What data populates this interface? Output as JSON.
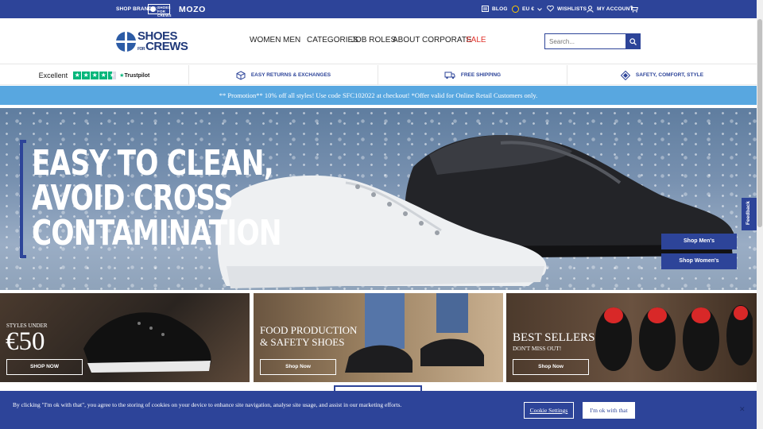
{
  "topbar": {
    "brands_label": "SHOP BRANDS:",
    "brand_sfc": "SHOES FOR CREWS",
    "brand_mozo": "MOZO",
    "blog": "BLOG",
    "currency": "EU €",
    "wishlists": "WISHLISTS",
    "account": "MY ACCOUNT"
  },
  "header": {
    "logo_line1": "SHOES",
    "logo_for": "FOR",
    "logo_line2": "CREWS",
    "nav": [
      "WOMEN",
      "MEN",
      "CATEGORIES",
      "JOB ROLES",
      "ABOUT",
      "CORPORATE",
      "SALE"
    ],
    "search_placeholder": "Search..."
  },
  "usp": {
    "trustpilot_rating": "Excellent",
    "trustpilot_brand": "Trustpilot",
    "trustpilot_stars": 4.5,
    "returns": "EASY RETURNS & EXCHANGES",
    "shipping": "FREE SHIPPING",
    "safety": "SAFETY, COMFORT, STYLE"
  },
  "promo": "** Promotion** 10% off all styles! Use code SFC102022 at checkout! *Offer valid for Online Retail Customers only.",
  "hero": {
    "title_lines": [
      "EASY TO CLEAN,",
      "AVOID CROSS",
      "CONTAMINATION"
    ],
    "btn_mens": "Shop Men's",
    "btn_womens": "Shop Women's"
  },
  "feedback": "Feedback",
  "tiles": [
    {
      "small": "STYLES UNDER",
      "big": "€50",
      "button": "SHOP NOW"
    },
    {
      "line1": "FOOD PRODUCTION",
      "line2": "& SAFETY SHOES",
      "button": "Shop Now"
    },
    {
      "title": "BEST SELLERS",
      "sub": "DON'T MISS OUT!",
      "button": "Shop Now"
    }
  ],
  "cookie": {
    "message": "By clicking \"I'm ok with that\", you agree to the storing of cookies on your device to enhance site navigation, analyse site usage, and assist in our marketing efforts.",
    "settings": "Cookie Settings",
    "accept": "I'm ok with that"
  },
  "colors": {
    "brand": "#2d4499",
    "promo": "#58a7e0",
    "sale": "#e0312a",
    "trustpilot": "#00b67a"
  }
}
